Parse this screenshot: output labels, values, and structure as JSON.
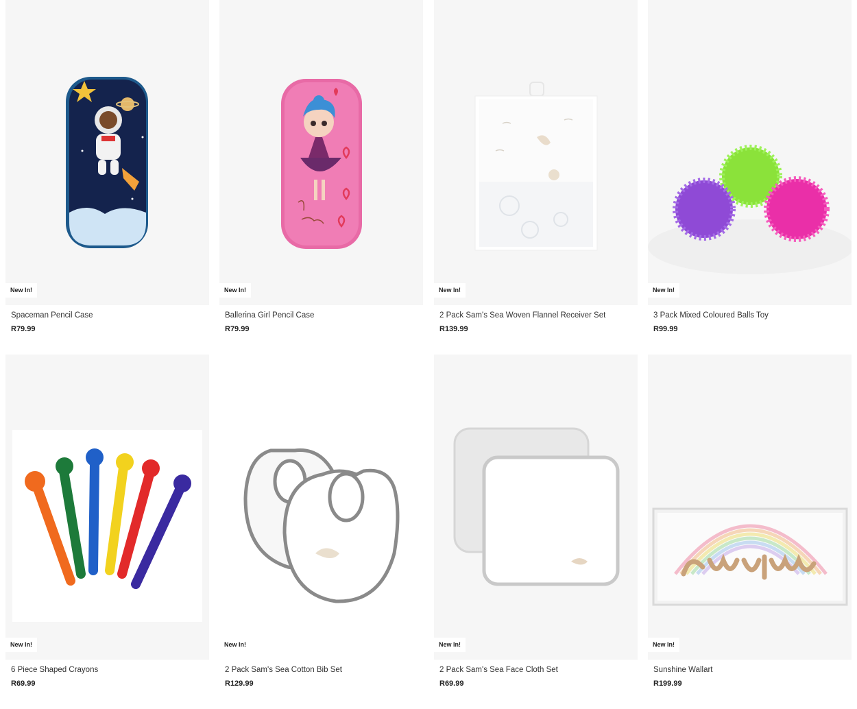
{
  "products": [
    {
      "name": "Spaceman Pencil Case",
      "price": "R79.99",
      "badge": "New In!",
      "icon": "spaceman-pencil-case-image"
    },
    {
      "name": "Ballerina Girl Pencil Case",
      "price": "R79.99",
      "badge": "New In!",
      "icon": "ballerina-pencil-case-image"
    },
    {
      "name": "2 Pack Sam's Sea Woven Flannel Receiver Set",
      "price": "R139.99",
      "badge": "New In!",
      "icon": "flannel-receiver-set-image"
    },
    {
      "name": "3 Pack Mixed Coloured Balls Toy",
      "price": "R99.99",
      "badge": "New In!",
      "icon": "spiky-balls-image"
    },
    {
      "name": "6 Piece Shaped Crayons",
      "price": "R69.99",
      "badge": "New In!",
      "icon": "shaped-crayons-image"
    },
    {
      "name": "2 Pack Sam's Sea Cotton Bib Set",
      "price": "R129.99",
      "badge": "New In!",
      "icon": "bib-set-image"
    },
    {
      "name": "2 Pack Sam's Sea Face Cloth Set",
      "price": "R69.99",
      "badge": "New In!",
      "icon": "face-cloth-set-image"
    },
    {
      "name": "Sunshine Wallart",
      "price": "R199.99",
      "badge": "New In!",
      "icon": "sunshine-wallart-image"
    }
  ],
  "colors": {
    "tile_background": "#f6f6f6",
    "price_text": "#222222"
  }
}
